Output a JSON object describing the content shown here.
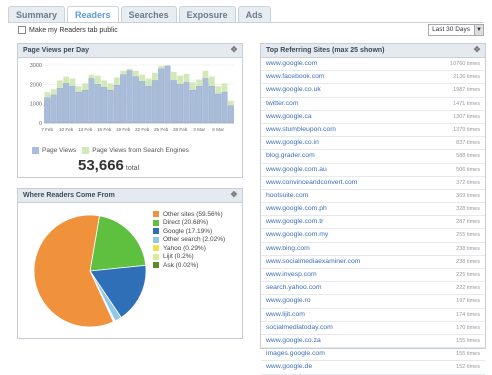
{
  "tabs": [
    {
      "label": "Summary",
      "active": false
    },
    {
      "label": "Readers",
      "active": true
    },
    {
      "label": "Searches",
      "active": false
    },
    {
      "label": "Exposure",
      "active": false
    },
    {
      "label": "Ads",
      "active": false
    }
  ],
  "public_label": "Make my Readers tab public",
  "date_range": "Last 30 Days",
  "page_views": {
    "title": "Page Views per Day",
    "legend": [
      "Page Views",
      "Page Views from Search Engines"
    ],
    "total": "53,666",
    "total_label": "total"
  },
  "chart_data": {
    "type": "bar",
    "categories": [
      "7 Feb",
      "",
      "",
      "10 Feb",
      "",
      "",
      "13 Feb",
      "",
      "",
      "16 Feb",
      "",
      "",
      "19 Feb",
      "",
      "",
      "22 Feb",
      "",
      "",
      "25 Feb",
      "",
      "",
      "28 Feb",
      "",
      "",
      "3 Mar",
      "",
      "",
      "6 Mar",
      "",
      ""
    ],
    "tick_labels": [
      "7 Feb",
      "10 Feb",
      "13 Feb",
      "16 Feb",
      "19 Feb",
      "22 Feb",
      "25 Feb",
      "28 Feb",
      "3 Mar",
      "6 Mar"
    ],
    "y_ticks": [
      "0",
      "1000",
      "2000",
      "3000"
    ],
    "ylim": [
      0,
      3000
    ],
    "series": [
      {
        "name": "Page Views",
        "values": [
          1300,
          1450,
          1800,
          2050,
          1900,
          1600,
          1700,
          2300,
          2000,
          1850,
          1700,
          1950,
          2500,
          2700,
          2400,
          2150,
          1900,
          2200,
          2800,
          2950,
          2200,
          2000,
          2100,
          1700,
          1900,
          2300,
          1900,
          1500,
          1600,
          900
        ]
      },
      {
        "name": "Page Views from Search Engines",
        "values": [
          1600,
          1750,
          2200,
          2400,
          2300,
          1900,
          2050,
          2500,
          2450,
          2200,
          2050,
          2350,
          2700,
          2800,
          2700,
          2500,
          2300,
          2600,
          2950,
          2980,
          2650,
          2450,
          2550,
          2100,
          2250,
          2700,
          2400,
          1900,
          2050,
          1150
        ]
      }
    ],
    "colors": [
      "#a9bcd9",
      "#d2e8b8"
    ]
  },
  "readers": {
    "title": "Where Readers Come From",
    "items": [
      {
        "label": "Other sites (59.56%)",
        "value": 59.56,
        "color": "#f0913c"
      },
      {
        "label": "Direct (20.68%)",
        "value": 20.68,
        "color": "#5fbf3f"
      },
      {
        "label": "Google (17.19%)",
        "value": 17.19,
        "color": "#2f6fb8"
      },
      {
        "label": "Other search (2.02%)",
        "value": 2.02,
        "color": "#8ec9e8"
      },
      {
        "label": "Yahoo (0.29%)",
        "value": 0.29,
        "color": "#f4e04a"
      },
      {
        "label": "Lijit (0.2%)",
        "value": 0.2,
        "color": "#d8ec9c"
      },
      {
        "label": "Ask (0.02%)",
        "value": 0.02,
        "color": "#5b8e2a"
      }
    ]
  },
  "referring": {
    "title": "Top Referring Sites (max 25 shown)",
    "rows": [
      {
        "site": "www.google.com",
        "times": "10760 times"
      },
      {
        "site": "www.facebook.com",
        "times": "2136 times"
      },
      {
        "site": "www.google.co.uk",
        "times": "1987 times"
      },
      {
        "site": "twitter.com",
        "times": "1471 times"
      },
      {
        "site": "www.google.ca",
        "times": "1307 times"
      },
      {
        "site": "www.stumbleupon.com",
        "times": "1379 times"
      },
      {
        "site": "www.google.co.in",
        "times": "837 times"
      },
      {
        "site": "blog.grader.com",
        "times": "588 times"
      },
      {
        "site": "www.google.com.au",
        "times": "506 times"
      },
      {
        "site": "www.convinceandconvert.com",
        "times": "372 times"
      },
      {
        "site": "hootsuite.com",
        "times": "369 times"
      },
      {
        "site": "www.google.com.ph",
        "times": "328 times"
      },
      {
        "site": "www.google.com.tr",
        "times": "287 times"
      },
      {
        "site": "www.google.com.my",
        "times": "255 times"
      },
      {
        "site": "www.bing.com",
        "times": "238 times"
      },
      {
        "site": "www.socialmediaexaminer.com",
        "times": "238 times"
      },
      {
        "site": "www.invesp.com",
        "times": "225 times"
      },
      {
        "site": "search.yahoo.com",
        "times": "222 times"
      },
      {
        "site": "www.google.ro",
        "times": "197 times"
      },
      {
        "site": "www.lijit.com",
        "times": "174 times"
      },
      {
        "site": "socialmediatoday.com",
        "times": "170 times"
      },
      {
        "site": "www.google.co.za",
        "times": "155 times"
      },
      {
        "site": "images.google.com",
        "times": "155 times"
      },
      {
        "site": "www.google.de",
        "times": "152 times"
      }
    ]
  }
}
